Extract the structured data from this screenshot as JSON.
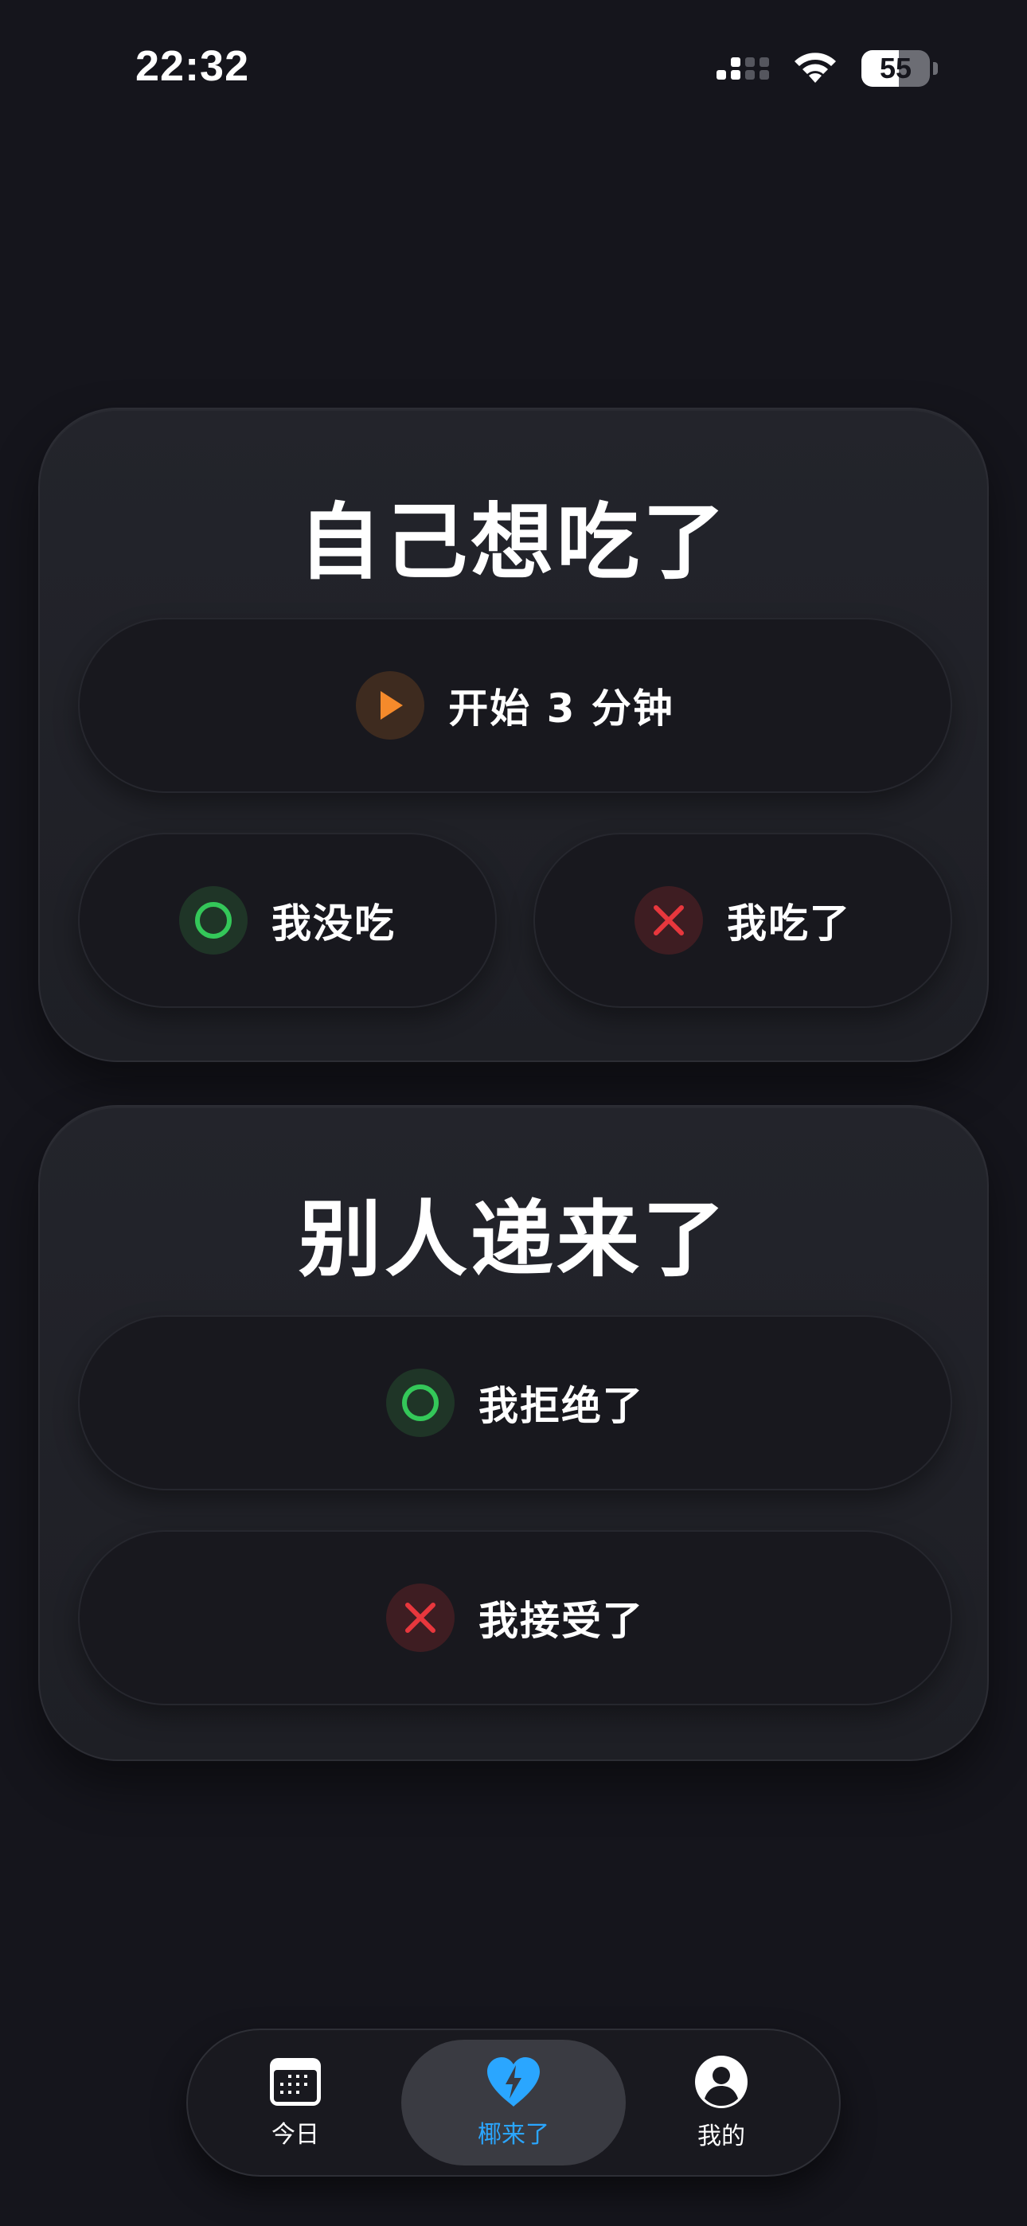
{
  "status_bar": {
    "time": "22:32",
    "battery_level": "55",
    "battery_fraction": 0.55,
    "signal_icon": "cellular-signal-icon",
    "wifi_icon": "wifi-icon"
  },
  "card_self": {
    "title": "自己想吃了",
    "start_button": {
      "label": "开始 3 分钟",
      "icon": "play-icon",
      "color": "#f58a2b"
    },
    "not_eaten_button": {
      "label": "我没吃",
      "icon": "circle-check-icon",
      "color": "#34c759"
    },
    "eaten_button": {
      "label": "我吃了",
      "icon": "close-icon",
      "color": "#e8373d"
    }
  },
  "card_others": {
    "title": "别人递来了",
    "refused_button": {
      "label": "我拒绝了",
      "icon": "circle-check-icon",
      "color": "#34c759"
    },
    "accepted_button": {
      "label": "我接受了",
      "icon": "close-icon",
      "color": "#e8373d"
    }
  },
  "tab_bar": {
    "tabs": [
      {
        "label": "今日",
        "icon": "calendar-icon",
        "active": false
      },
      {
        "label": "椰来了",
        "icon": "heart-bolt-icon",
        "active": true
      },
      {
        "label": "我的",
        "icon": "profile-icon",
        "active": false
      }
    ],
    "accent_color": "#2aa6ff"
  }
}
